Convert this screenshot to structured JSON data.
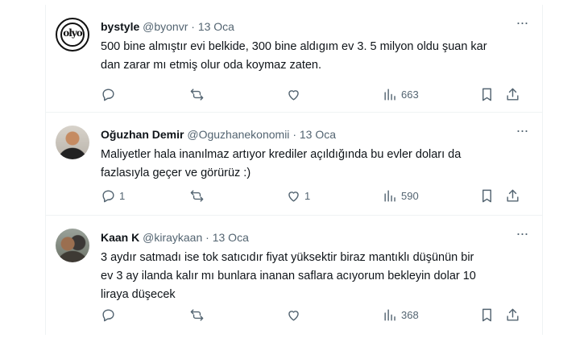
{
  "tweets": [
    {
      "name": "bystyle",
      "handle": "@byonvr",
      "dot": "·",
      "date": "13 Oca",
      "avatar_mark": "olyo",
      "text": "500 bine almıştır evi belkide, 300 bine aldıgım ev 3. 5 milyon oldu şuan kar\ndan zarar mı etmiş olur oda koymaz zaten.",
      "replies": "",
      "retweets": "",
      "likes": "",
      "views": "663"
    },
    {
      "name": "Oğuzhan Demir",
      "handle": "@Oguzhanekonomii",
      "dot": "·",
      "date": "13 Oca",
      "text": "Maliyetler hala inanılmaz artıyor krediler açıldığında bu evler doları da\nfazlasıyla geçer ve görürüz :)",
      "replies": "1",
      "retweets": "",
      "likes": "1",
      "views": "590"
    },
    {
      "name": "Kaan K",
      "handle": "@kiraykaan",
      "dot": "·",
      "date": "13 Oca",
      "text": "3 aydır satmadı ise tok satıcıdır fiyat yüksektir biraz mantıklı düşünün bir\nev 3 ay ilanda kalır mı bunlara inanan saflara acıyorum bekleyin dolar 10\nliraya düşecek",
      "replies": "",
      "retweets": "",
      "likes": "",
      "views": "368"
    }
  ],
  "more_glyph": "···",
  "icons": [
    "reply-icon",
    "retweet-icon",
    "like-icon",
    "views-icon",
    "bookmark-icon",
    "share-icon",
    "more-icon"
  ]
}
